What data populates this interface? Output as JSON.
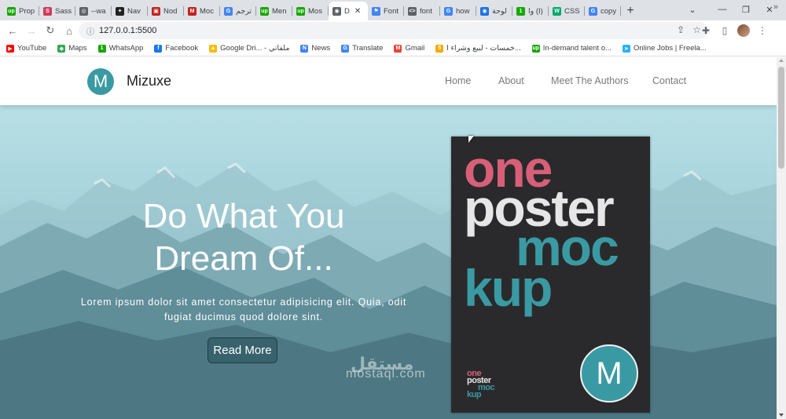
{
  "tabs": [
    {
      "label": "Prop",
      "color": "#14a800",
      "glyph": "up"
    },
    {
      "label": "Sass",
      "color": "#d33a5a",
      "glyph": "S"
    },
    {
      "label": "--wa",
      "color": "#5f6368",
      "glyph": "◎"
    },
    {
      "label": "Nav",
      "color": "#202124",
      "glyph": "✦"
    },
    {
      "label": "Nod",
      "color": "#c5221f",
      "glyph": "▣"
    },
    {
      "label": "Moc",
      "color": "#c5221f",
      "glyph": "M"
    },
    {
      "label": "ترجم",
      "color": "#4285f4",
      "glyph": "G"
    },
    {
      "label": "Men",
      "color": "#14a800",
      "glyph": "up"
    },
    {
      "label": "Mos",
      "color": "#14a800",
      "glyph": "up"
    },
    {
      "label": "D",
      "color": "#5f6368",
      "glyph": "◉"
    },
    {
      "label": "Font",
      "color": "#4285f4",
      "glyph": "⚑"
    },
    {
      "label": "font",
      "color": "#5f6368",
      "glyph": "<>"
    },
    {
      "label": "how",
      "color": "#4285f4",
      "glyph": "G"
    },
    {
      "label": "لوحة",
      "color": "#1a73e8",
      "glyph": "◉"
    },
    {
      "label": "وا (I)",
      "color": "#14a800",
      "glyph": "1"
    },
    {
      "label": "CSS",
      "color": "#04aa6d",
      "glyph": "W"
    },
    {
      "label": "copy",
      "color": "#4285f4",
      "glyph": "G"
    }
  ],
  "new_tab_label": "+",
  "window_controls": {
    "dropdown": "⌄",
    "minimize": "—",
    "restore": "❐",
    "close": "✕"
  },
  "address": {
    "url": "127.0.0.1:5500"
  },
  "bookmarks": [
    {
      "label": "YouTube",
      "color": "#ff0000",
      "glyph": "▶"
    },
    {
      "label": "Maps",
      "color": "#34a853",
      "glyph": "◆"
    },
    {
      "label": "WhatsApp",
      "color": "#14a800",
      "glyph": "1"
    },
    {
      "label": "Facebook",
      "color": "#1877f2",
      "glyph": "f"
    },
    {
      "label": "Google Dri... - ملفاتي",
      "color": "#fbbc04",
      "glyph": "▲"
    },
    {
      "label": "News",
      "color": "#4285f4",
      "glyph": "N"
    },
    {
      "label": "Translate",
      "color": "#4285f4",
      "glyph": "G"
    },
    {
      "label": "Gmail",
      "color": "#ea4335",
      "glyph": "M"
    },
    {
      "label": "خمسات - لبيع وشراء ا...",
      "color": "#f6a800",
      "glyph": "5"
    },
    {
      "label": "In-demand talent o...",
      "color": "#14a800",
      "glyph": "up"
    },
    {
      "label": "Online Jobs | Freela...",
      "color": "#29b2fe",
      "glyph": "➤"
    }
  ],
  "bookmarks_more": "»",
  "site": {
    "brand_initial": "M",
    "brand_name": "Mizuxe",
    "nav": {
      "home": "Home",
      "about": "About",
      "authors": "Meet The Authors",
      "contact": "Contact"
    },
    "hero": {
      "title": "Do What You Dream Of...",
      "text": "Lorem ipsum dolor sit amet consectetur adipisicing elit. Quia, odit fugiat ducimus quod dolore sint.",
      "button": "Read More"
    },
    "poster": {
      "line1": "one",
      "line2": "poster",
      "line3": "moc",
      "line4": "kup",
      "badge": "M",
      "small1": "one",
      "small2": "poster",
      "small3": "moc",
      "small4": "kup"
    }
  },
  "watermark": {
    "arabic": "مستقل",
    "latin": "mostaql.com"
  },
  "colors": {
    "accent": "#3a9aa3",
    "pink": "#d85f78",
    "poster_bg": "#2a2a2c"
  }
}
